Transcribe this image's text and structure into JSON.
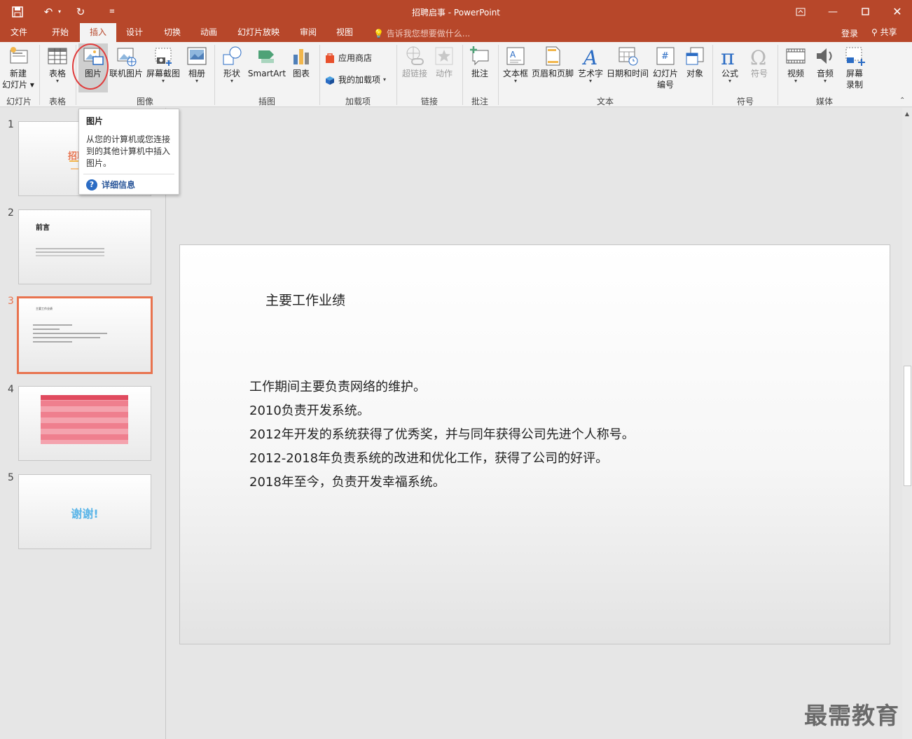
{
  "app": {
    "title": "招聘启事 - PowerPoint",
    "accent_color": "#b7472a",
    "quick_access": [
      "save-icon",
      "undo-icon",
      "redo-icon",
      "customize-icon"
    ]
  },
  "tabs": {
    "items": [
      "文件",
      "开始",
      "插入",
      "设计",
      "切换",
      "动画",
      "幻灯片放映",
      "审阅",
      "视图"
    ],
    "active": "插入",
    "tell_me": "告诉我您想要做什么...",
    "login": "登录",
    "share": "共享"
  },
  "ribbon": {
    "new_slide": "新建",
    "new_slide2": "幻灯片",
    "table": "表格",
    "picture": "图片",
    "online_picture": "联机图片",
    "screenshot": "屏幕截图",
    "album": "相册",
    "shapes": "形状",
    "smartart": "SmartArt",
    "chart": "图表",
    "app_store": "应用商店",
    "my_addins": "我的加载项",
    "hyperlink": "超链接",
    "action": "动作",
    "comment": "批注",
    "textbox": "文本框",
    "header_footer": "页眉和页脚",
    "wordart": "艺术字",
    "datetime": "日期和时间",
    "slide_number": "幻灯片",
    "slide_number2": "编号",
    "object": "对象",
    "equation": "公式",
    "symbol": "符号",
    "video": "视频",
    "audio": "音频",
    "screen_record": "屏幕",
    "screen_record2": "录制",
    "groups": {
      "slides": "幻灯片",
      "tables": "表格",
      "images": "图像",
      "illustrations": "插图",
      "addins": "加载项",
      "links": "链接",
      "comments": "批注",
      "text": "文本",
      "symbols": "符号",
      "media": "媒体"
    }
  },
  "tooltip": {
    "title": "图片",
    "description": "从您的计算机或您连接到的其他计算机中插入图片。",
    "more": "详细信息"
  },
  "thumbnails": [
    {
      "num": "1",
      "text": "招聘"
    },
    {
      "num": "2",
      "heading": "前言"
    },
    {
      "num": "3",
      "heading": "主要工作业绩"
    },
    {
      "num": "4"
    },
    {
      "num": "5",
      "text": "谢谢!"
    }
  ],
  "slide": {
    "title": "主要工作业绩",
    "lines": [
      "工作期间主要负责网络的维护。",
      "2010负责开发系统。",
      "2012年开发的系统获得了优秀奖，并与同年获得公司先进个人称号。",
      "2012-2018年负责系统的改进和优化工作，获得了公司的好评。",
      "2018年至今，负责开发幸福系统。"
    ]
  },
  "watermark": "最需教育"
}
